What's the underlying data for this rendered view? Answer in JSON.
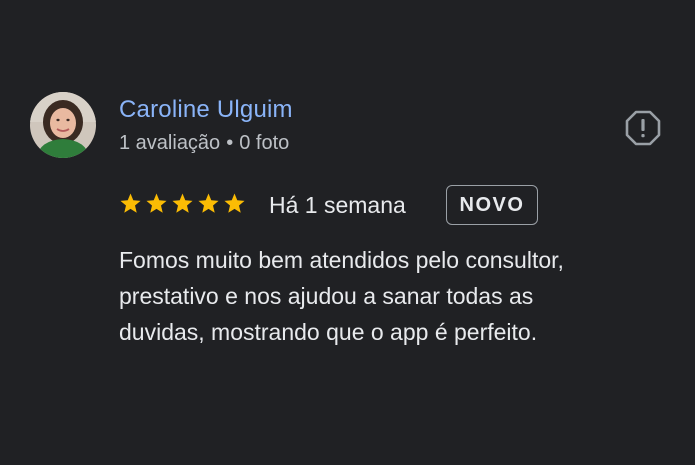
{
  "reviewer": {
    "name": "Caroline Ulguim",
    "review_count": "1 avaliação",
    "separator": "•",
    "photo_count": "0 foto"
  },
  "review": {
    "rating": 5,
    "max_rating": 5,
    "date": "Há 1 semana",
    "badge": "NOVO",
    "text_lines": [
      "Fomos muito bem atendidos pelo consultor,",
      "prestativo e nos ajudou a sanar todas as",
      "duvidas, mostrando que o app é perfeito."
    ]
  },
  "icons": {
    "report": "report-flag-icon",
    "star": "star-icon"
  },
  "colors": {
    "background": "#202124",
    "name": "#8ab4f8",
    "star": "#fbbc04",
    "text": "#e8eaed",
    "meta": "#bdc1c6"
  }
}
